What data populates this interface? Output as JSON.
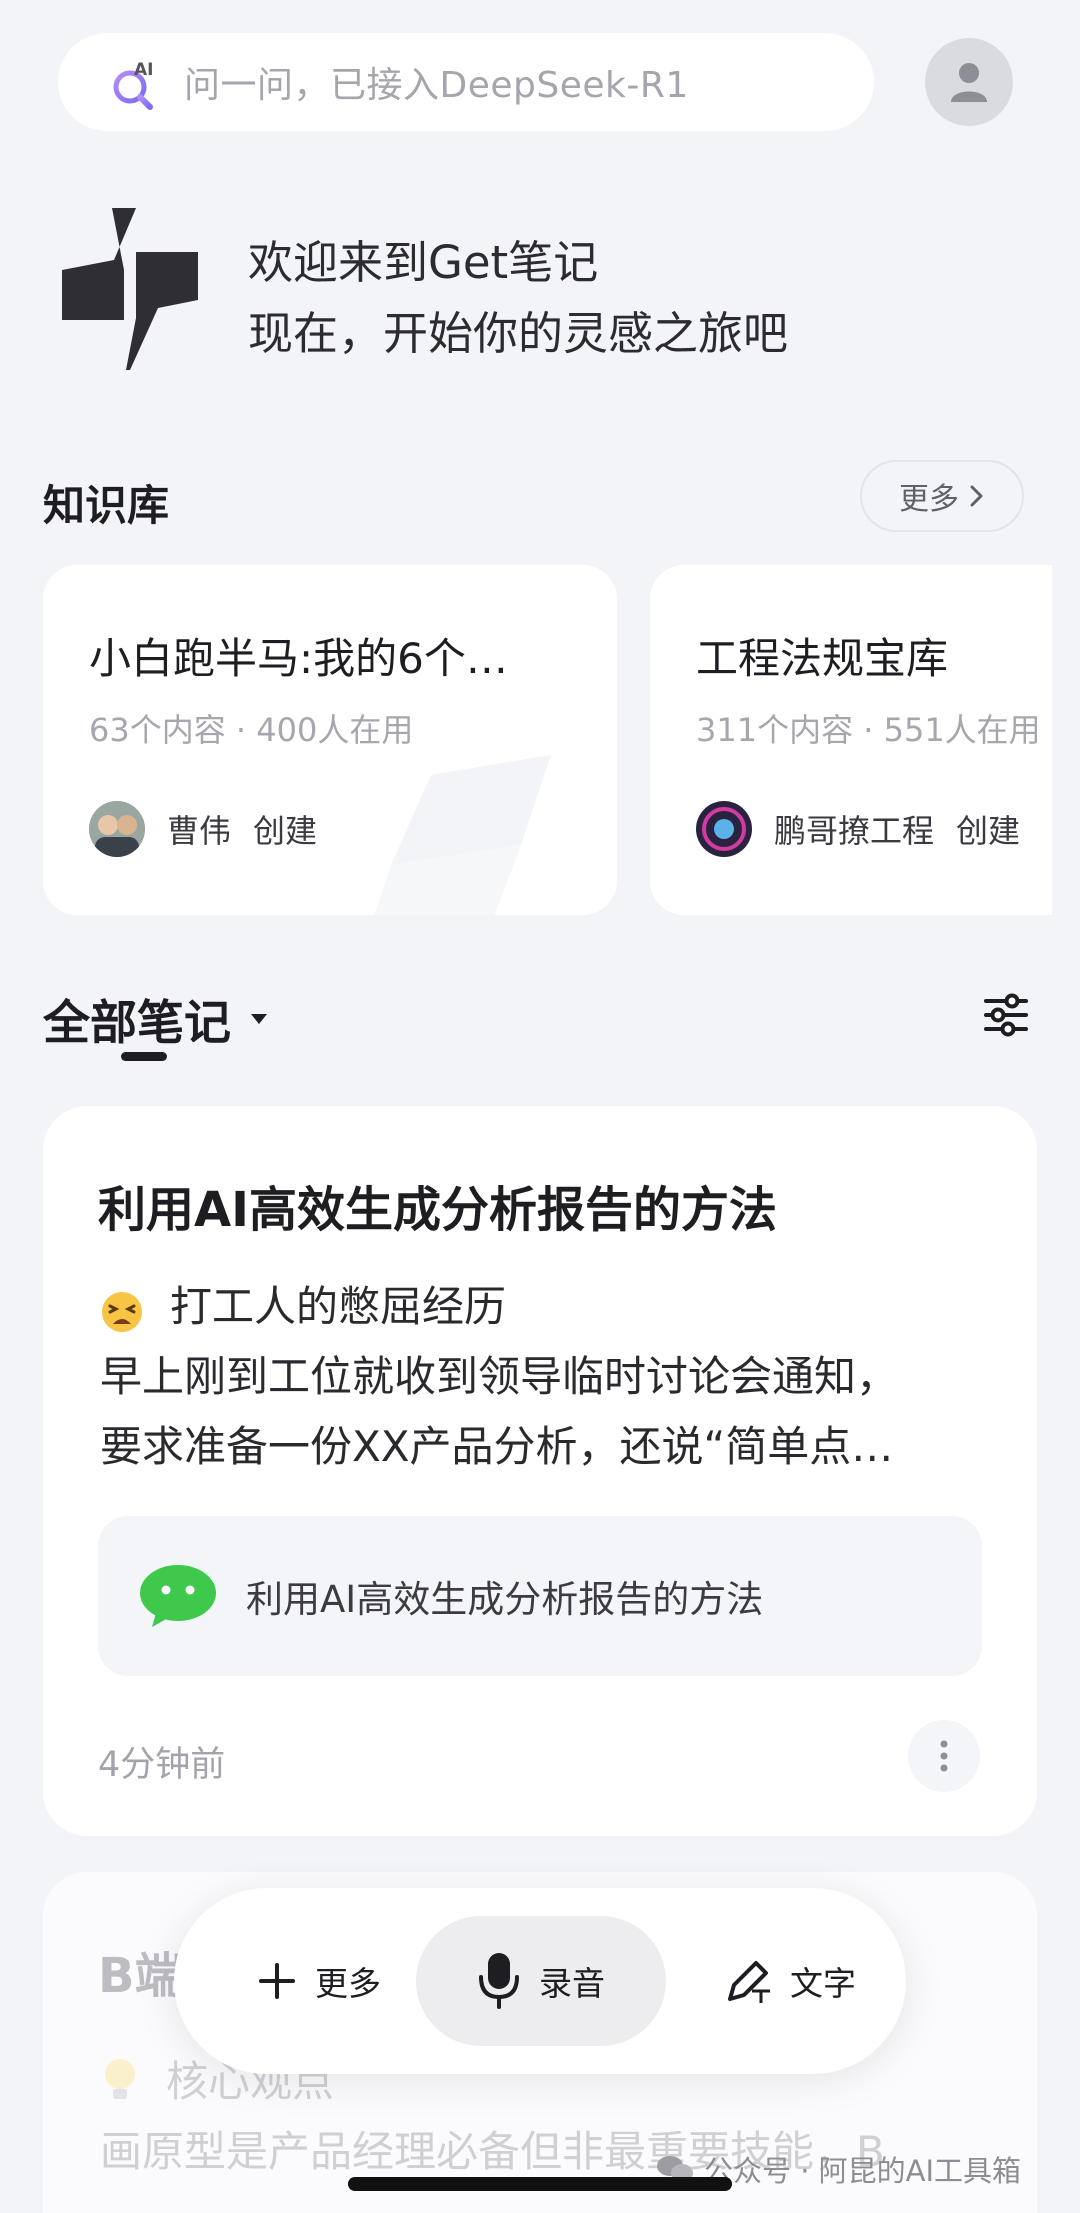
{
  "search": {
    "badge": "AI",
    "placeholder": "问一问，已接入DeepSeek-R1"
  },
  "welcome": {
    "line1": "欢迎来到Get笔记",
    "line2": "现在，开始你的灵感之旅吧"
  },
  "knowledge_base": {
    "title": "知识库",
    "more_label": "更多",
    "cards": [
      {
        "title": "小白跑半马:我的6个…",
        "meta": "63个内容 · 400人在用",
        "creator": "曹伟",
        "created_label": "创建"
      },
      {
        "title": "工程法规宝库",
        "meta": "311个内容 · 551人在用",
        "creator": "鹏哥撩工程",
        "created_label": "创建"
      }
    ]
  },
  "notes": {
    "title": "全部笔记",
    "items": [
      {
        "title": "利用AI高效生成分析报告的方法",
        "emoji": "tired-face",
        "subtitle": "打工人的憋屈经历",
        "line1": "早上刚到工位就收到领导临时讨论会通知，",
        "line2": "要求准备一份XX产品分析，还说“简单点…",
        "source_title": "利用AI高效生成分析报告的方法",
        "source_icon": "wechat-icon",
        "time": "4分钟前"
      },
      {
        "title": "B端",
        "emoji": "light-bulb",
        "subtitle": "核心观点",
        "line1": "画原型是产品经理必备但非最重要技能，B"
      }
    ]
  },
  "action_bar": {
    "more_label": "更多",
    "record_label": "录音",
    "text_label": "文字"
  },
  "watermark": "公众号 · 阿昆的AI工具箱",
  "colors": {
    "background": "#f3f4f8",
    "card": "#ffffff",
    "accent_purple": "#8b6cf0",
    "wechat_green": "#3ec94c"
  }
}
